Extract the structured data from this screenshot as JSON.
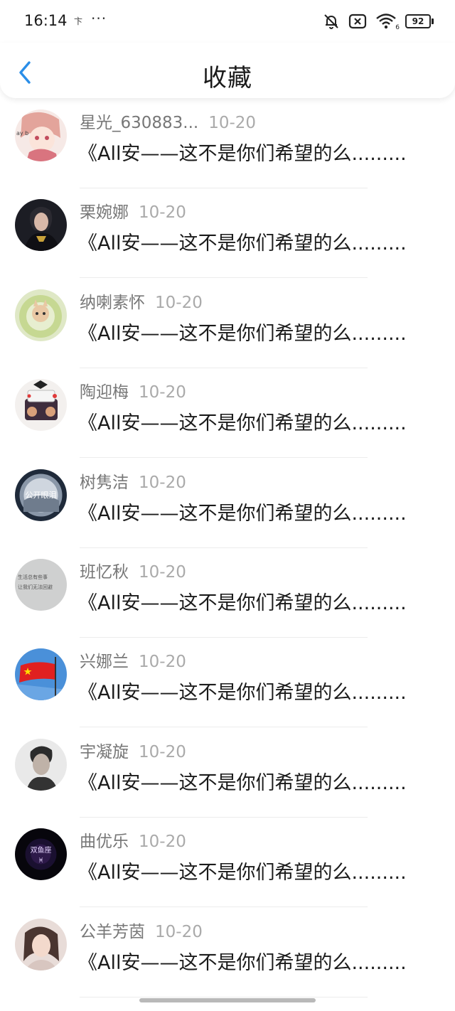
{
  "status_bar": {
    "time": "16:14",
    "notif_glyph": "卞",
    "dots": "···",
    "signal_badge": "6",
    "battery": "92",
    "battery_level": 0.92,
    "icons": [
      "bell-off-icon",
      "sim-off-icon",
      "wifi-icon",
      "battery-icon"
    ]
  },
  "header": {
    "back_icon": "chevron-left-icon",
    "title": "收藏",
    "accent_color": "#2a8ee8"
  },
  "items": [
    {
      "user": "星光_630883...",
      "date": "10-20",
      "title": "《All安——这不是你们希望的么........."
    },
    {
      "user": "栗婉娜",
      "date": "10-20",
      "title": "《All安——这不是你们希望的么........."
    },
    {
      "user": "纳喇素怀",
      "date": "10-20",
      "title": "《All安——这不是你们希望的么........."
    },
    {
      "user": "陶迎梅",
      "date": "10-20",
      "title": "《All安——这不是你们希望的么........."
    },
    {
      "user": "树隽洁",
      "date": "10-20",
      "title": "《All安——这不是你们希望的么........."
    },
    {
      "user": "班忆秋",
      "date": "10-20",
      "title": "《All安——这不是你们希望的么........."
    },
    {
      "user": "兴娜兰",
      "date": "10-20",
      "title": "《All安——这不是你们希望的么........."
    },
    {
      "user": "宇凝旋",
      "date": "10-20",
      "title": "《All安——这不是你们希望的么........."
    },
    {
      "user": "曲优乐",
      "date": "10-20",
      "title": "《All安——这不是你们希望的么........."
    },
    {
      "user": "公羊芳茵",
      "date": "10-20",
      "title": "《All安——这不是你们希望的么........."
    }
  ],
  "avatar_text": {
    "a1": "ay b",
    "a5": "公开眼泪",
    "a6_line1": "生活总有些事",
    "a6_line2": "让我们无法回避",
    "a9_line1": "双鱼座",
    "a9_line2": "♓"
  }
}
